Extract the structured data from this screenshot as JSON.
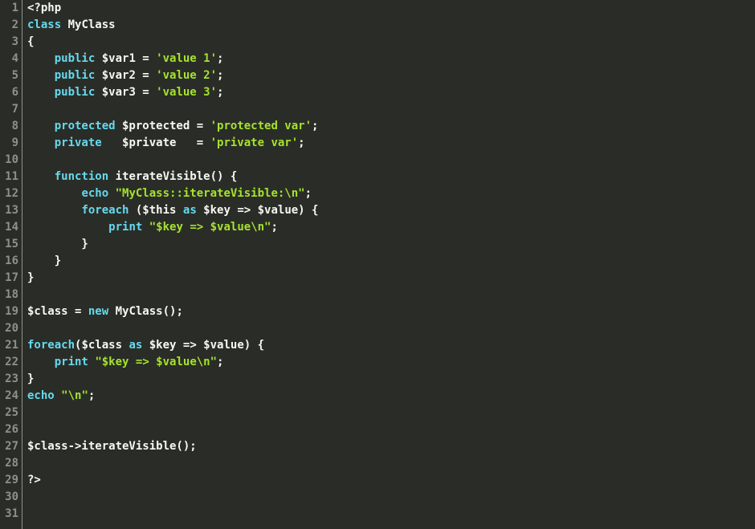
{
  "editor": {
    "line_count": 31,
    "lines": {
      "l1": [
        {
          "c": "tok-default",
          "t": "<?php"
        }
      ],
      "l2": [
        {
          "c": "tok-kw",
          "t": "class"
        },
        {
          "c": "tok-default",
          "t": " MyClass"
        }
      ],
      "l3": [
        {
          "c": "tok-default",
          "t": "{"
        }
      ],
      "l4": [
        {
          "c": "tok-default",
          "t": "    "
        },
        {
          "c": "tok-kw",
          "t": "public"
        },
        {
          "c": "tok-default",
          "t": " $var1 = "
        },
        {
          "c": "tok-str",
          "t": "'value 1'"
        },
        {
          "c": "tok-default",
          "t": ";"
        }
      ],
      "l5": [
        {
          "c": "tok-default",
          "t": "    "
        },
        {
          "c": "tok-kw",
          "t": "public"
        },
        {
          "c": "tok-default",
          "t": " $var2 = "
        },
        {
          "c": "tok-str",
          "t": "'value 2'"
        },
        {
          "c": "tok-default",
          "t": ";"
        }
      ],
      "l6": [
        {
          "c": "tok-default",
          "t": "    "
        },
        {
          "c": "tok-kw",
          "t": "public"
        },
        {
          "c": "tok-default",
          "t": " $var3 = "
        },
        {
          "c": "tok-str",
          "t": "'value 3'"
        },
        {
          "c": "tok-default",
          "t": ";"
        }
      ],
      "l7": [
        {
          "c": "tok-default",
          "t": ""
        }
      ],
      "l8": [
        {
          "c": "tok-default",
          "t": "    "
        },
        {
          "c": "tok-kw",
          "t": "protected"
        },
        {
          "c": "tok-default",
          "t": " $protected = "
        },
        {
          "c": "tok-str",
          "t": "'protected var'"
        },
        {
          "c": "tok-default",
          "t": ";"
        }
      ],
      "l9": [
        {
          "c": "tok-default",
          "t": "    "
        },
        {
          "c": "tok-kw",
          "t": "private"
        },
        {
          "c": "tok-default",
          "t": "   $private   = "
        },
        {
          "c": "tok-str",
          "t": "'private var'"
        },
        {
          "c": "tok-default",
          "t": ";"
        }
      ],
      "l10": [
        {
          "c": "tok-default",
          "t": ""
        }
      ],
      "l11": [
        {
          "c": "tok-default",
          "t": "    "
        },
        {
          "c": "tok-kw",
          "t": "function"
        },
        {
          "c": "tok-default",
          "t": " iterateVisible() {"
        }
      ],
      "l12": [
        {
          "c": "tok-default",
          "t": "        "
        },
        {
          "c": "tok-kw",
          "t": "echo"
        },
        {
          "c": "tok-default",
          "t": " "
        },
        {
          "c": "tok-str",
          "t": "\"MyClass::iterateVisible:\\n\""
        },
        {
          "c": "tok-default",
          "t": ";"
        }
      ],
      "l13": [
        {
          "c": "tok-default",
          "t": "        "
        },
        {
          "c": "tok-kw",
          "t": "foreach"
        },
        {
          "c": "tok-default",
          "t": " ($this "
        },
        {
          "c": "tok-kw",
          "t": "as"
        },
        {
          "c": "tok-default",
          "t": " $key => $value) {"
        }
      ],
      "l14": [
        {
          "c": "tok-default",
          "t": "            "
        },
        {
          "c": "tok-kw",
          "t": "print"
        },
        {
          "c": "tok-default",
          "t": " "
        },
        {
          "c": "tok-str",
          "t": "\"$key => $value\\n\""
        },
        {
          "c": "tok-default",
          "t": ";"
        }
      ],
      "l15": [
        {
          "c": "tok-default",
          "t": "        }"
        }
      ],
      "l16": [
        {
          "c": "tok-default",
          "t": "    }"
        }
      ],
      "l17": [
        {
          "c": "tok-default",
          "t": "}"
        }
      ],
      "l18": [
        {
          "c": "tok-default",
          "t": ""
        }
      ],
      "l19": [
        {
          "c": "tok-default",
          "t": "$class = "
        },
        {
          "c": "tok-kw",
          "t": "new"
        },
        {
          "c": "tok-default",
          "t": " MyClass();"
        }
      ],
      "l20": [
        {
          "c": "tok-default",
          "t": ""
        }
      ],
      "l21": [
        {
          "c": "tok-kw",
          "t": "foreach"
        },
        {
          "c": "tok-default",
          "t": "($class "
        },
        {
          "c": "tok-kw",
          "t": "as"
        },
        {
          "c": "tok-default",
          "t": " $key => $value) {"
        }
      ],
      "l22": [
        {
          "c": "tok-default",
          "t": "    "
        },
        {
          "c": "tok-kw",
          "t": "print"
        },
        {
          "c": "tok-default",
          "t": " "
        },
        {
          "c": "tok-str",
          "t": "\"$key => $value\\n\""
        },
        {
          "c": "tok-default",
          "t": ";"
        }
      ],
      "l23": [
        {
          "c": "tok-default",
          "t": "}"
        }
      ],
      "l24": [
        {
          "c": "tok-kw",
          "t": "echo"
        },
        {
          "c": "tok-default",
          "t": " "
        },
        {
          "c": "tok-str",
          "t": "\"\\n\""
        },
        {
          "c": "tok-default",
          "t": ";"
        }
      ],
      "l25": [
        {
          "c": "tok-default",
          "t": ""
        }
      ],
      "l26": [
        {
          "c": "tok-default",
          "t": ""
        }
      ],
      "l27": [
        {
          "c": "tok-default",
          "t": "$class->iterateVisible();"
        }
      ],
      "l28": [
        {
          "c": "tok-default",
          "t": ""
        }
      ],
      "l29": [
        {
          "c": "tok-default",
          "t": "?>"
        }
      ],
      "l30": [
        {
          "c": "tok-default",
          "t": ""
        }
      ],
      "l31": [
        {
          "c": "tok-default",
          "t": ""
        }
      ]
    }
  }
}
